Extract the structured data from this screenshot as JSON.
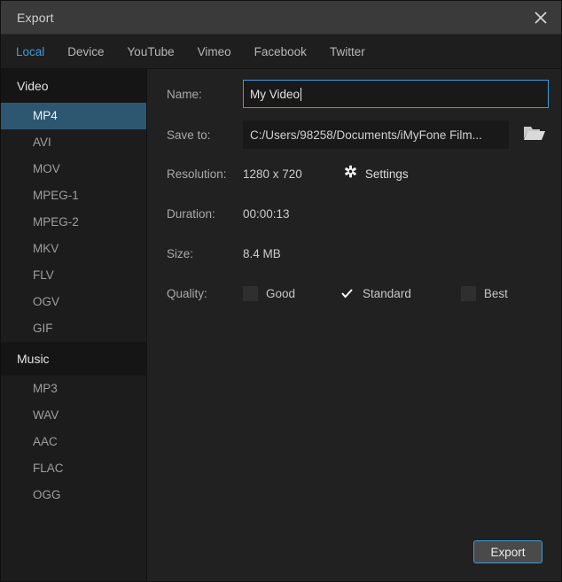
{
  "window": {
    "title": "Export",
    "close_icon": "close-icon"
  },
  "tabs": [
    {
      "label": "Local",
      "active": true
    },
    {
      "label": "Device",
      "active": false
    },
    {
      "label": "YouTube",
      "active": false
    },
    {
      "label": "Vimeo",
      "active": false
    },
    {
      "label": "Facebook",
      "active": false
    },
    {
      "label": "Twitter",
      "active": false
    }
  ],
  "sidebar": {
    "video_group": "Video",
    "video_formats": [
      {
        "label": "MP4",
        "selected": true
      },
      {
        "label": "AVI",
        "selected": false
      },
      {
        "label": "MOV",
        "selected": false
      },
      {
        "label": "MPEG-1",
        "selected": false
      },
      {
        "label": "MPEG-2",
        "selected": false
      },
      {
        "label": "MKV",
        "selected": false
      },
      {
        "label": "FLV",
        "selected": false
      },
      {
        "label": "OGV",
        "selected": false
      },
      {
        "label": "GIF",
        "selected": false
      }
    ],
    "music_group": "Music",
    "music_formats": [
      {
        "label": "MP3",
        "selected": false
      },
      {
        "label": "WAV",
        "selected": false
      },
      {
        "label": "AAC",
        "selected": false
      },
      {
        "label": "FLAC",
        "selected": false
      },
      {
        "label": "OGG",
        "selected": false
      }
    ]
  },
  "form": {
    "name_label": "Name:",
    "name_value": "My Video",
    "name_placeholder": "My Video",
    "saveto_label": "Save to:",
    "saveto_value": "C:/Users/98258/Documents/iMyFone Film...",
    "saveto_placeholder": "C:/Users/98258/Documents/iMyFone Film...",
    "folder_icon": "folder-icon",
    "resolution_label": "Resolution:",
    "resolution_value": "1280 x 720",
    "settings_icon": "gear-icon",
    "settings_label": "Settings",
    "duration_label": "Duration:",
    "duration_value": "00:00:13",
    "size_label": "Size:",
    "size_value": "8.4 MB",
    "quality_label": "Quality:",
    "quality_options": [
      {
        "label": "Good",
        "checked": false
      },
      {
        "label": "Standard",
        "checked": true
      },
      {
        "label": "Best",
        "checked": false
      }
    ]
  },
  "footer": {
    "export_label": "Export"
  },
  "colors": {
    "accent": "#3e9cd8",
    "selection": "#2d5770",
    "titlebar": "#3a3a3a",
    "sidebar_bg": "#1c1c1c",
    "main_bg": "#212121",
    "input_bg": "#191919",
    "text_primary": "#e3e3e3",
    "text_secondary": "#a9a9a9"
  }
}
